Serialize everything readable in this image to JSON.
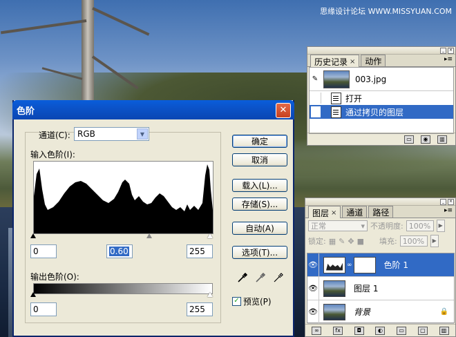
{
  "watermark": "思缘设计论坛 WWW.MISSYUAN.COM",
  "history_panel": {
    "tabs": [
      "历史记录",
      "动作"
    ],
    "snapshot": "003.jpg",
    "items": [
      "打开",
      "通过拷贝的图层"
    ]
  },
  "layers_panel": {
    "tabs": [
      "图层",
      "通道",
      "路径"
    ],
    "blend_mode": "正常",
    "opacity_label": "不透明度:",
    "opacity_value": "100%",
    "lock_label": "锁定:",
    "fill_label": "填充:",
    "fill_value": "100%",
    "layers": [
      {
        "name": "色阶 1",
        "selected": true
      },
      {
        "name": "图层 1",
        "selected": false
      },
      {
        "name": "背景",
        "selected": false
      }
    ]
  },
  "levels_dialog": {
    "title": "色阶",
    "channel_label": "通道(C):",
    "channel_value": "RGB",
    "input_label": "输入色阶(I):",
    "input_black": "0",
    "input_gamma": "0.60",
    "input_white": "255",
    "output_label": "输出色阶(O):",
    "output_black": "0",
    "output_white": "255",
    "buttons": {
      "ok": "确定",
      "cancel": "取消",
      "load": "载入(L)...",
      "save": "存储(S)...",
      "auto": "自动(A)",
      "options": "选项(T)..."
    },
    "preview_label": "预览(P)",
    "preview_checked": true
  }
}
